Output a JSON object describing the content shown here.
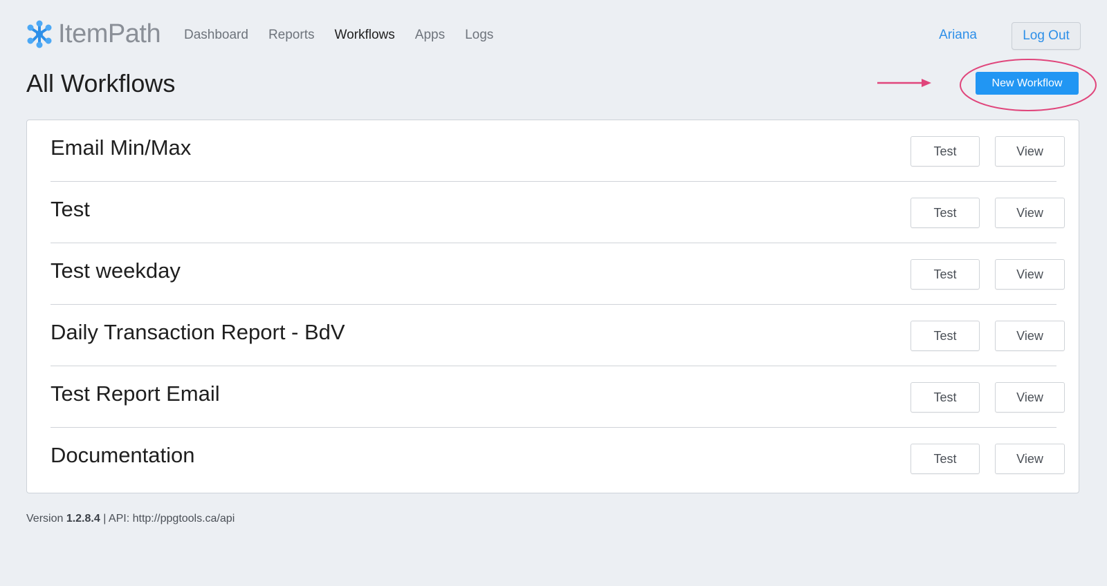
{
  "app": {
    "logo_text": "ItemPath",
    "logo_icon": "molecule-logo-icon",
    "accent": "#2196f3"
  },
  "nav": {
    "items": [
      {
        "label": "Dashboard",
        "active": false
      },
      {
        "label": "Reports",
        "active": false
      },
      {
        "label": "Workflows",
        "active": true
      },
      {
        "label": "Apps",
        "active": false
      },
      {
        "label": "Logs",
        "active": false
      }
    ]
  },
  "user": {
    "name": "Ariana",
    "logout_label": "Log Out"
  },
  "page": {
    "title": "All Workflows",
    "new_button_label": "New Workflow",
    "annotation_color": "#e0457b"
  },
  "workflows": [
    {
      "name": "Email Min/Max",
      "test_label": "Test",
      "view_label": "View"
    },
    {
      "name": "Test",
      "test_label": "Test",
      "view_label": "View"
    },
    {
      "name": "Test weekday",
      "test_label": "Test",
      "view_label": "View"
    },
    {
      "name": "Daily Transaction Report - BdV",
      "test_label": "Test",
      "view_label": "View"
    },
    {
      "name": "Test Report Email",
      "test_label": "Test",
      "view_label": "View"
    },
    {
      "name": "Documentation",
      "test_label": "Test",
      "view_label": "View"
    }
  ],
  "footer": {
    "version_prefix": "Version ",
    "version": "1.2.8.4",
    "api_text": " | API: http://ppgtools.ca/api"
  }
}
